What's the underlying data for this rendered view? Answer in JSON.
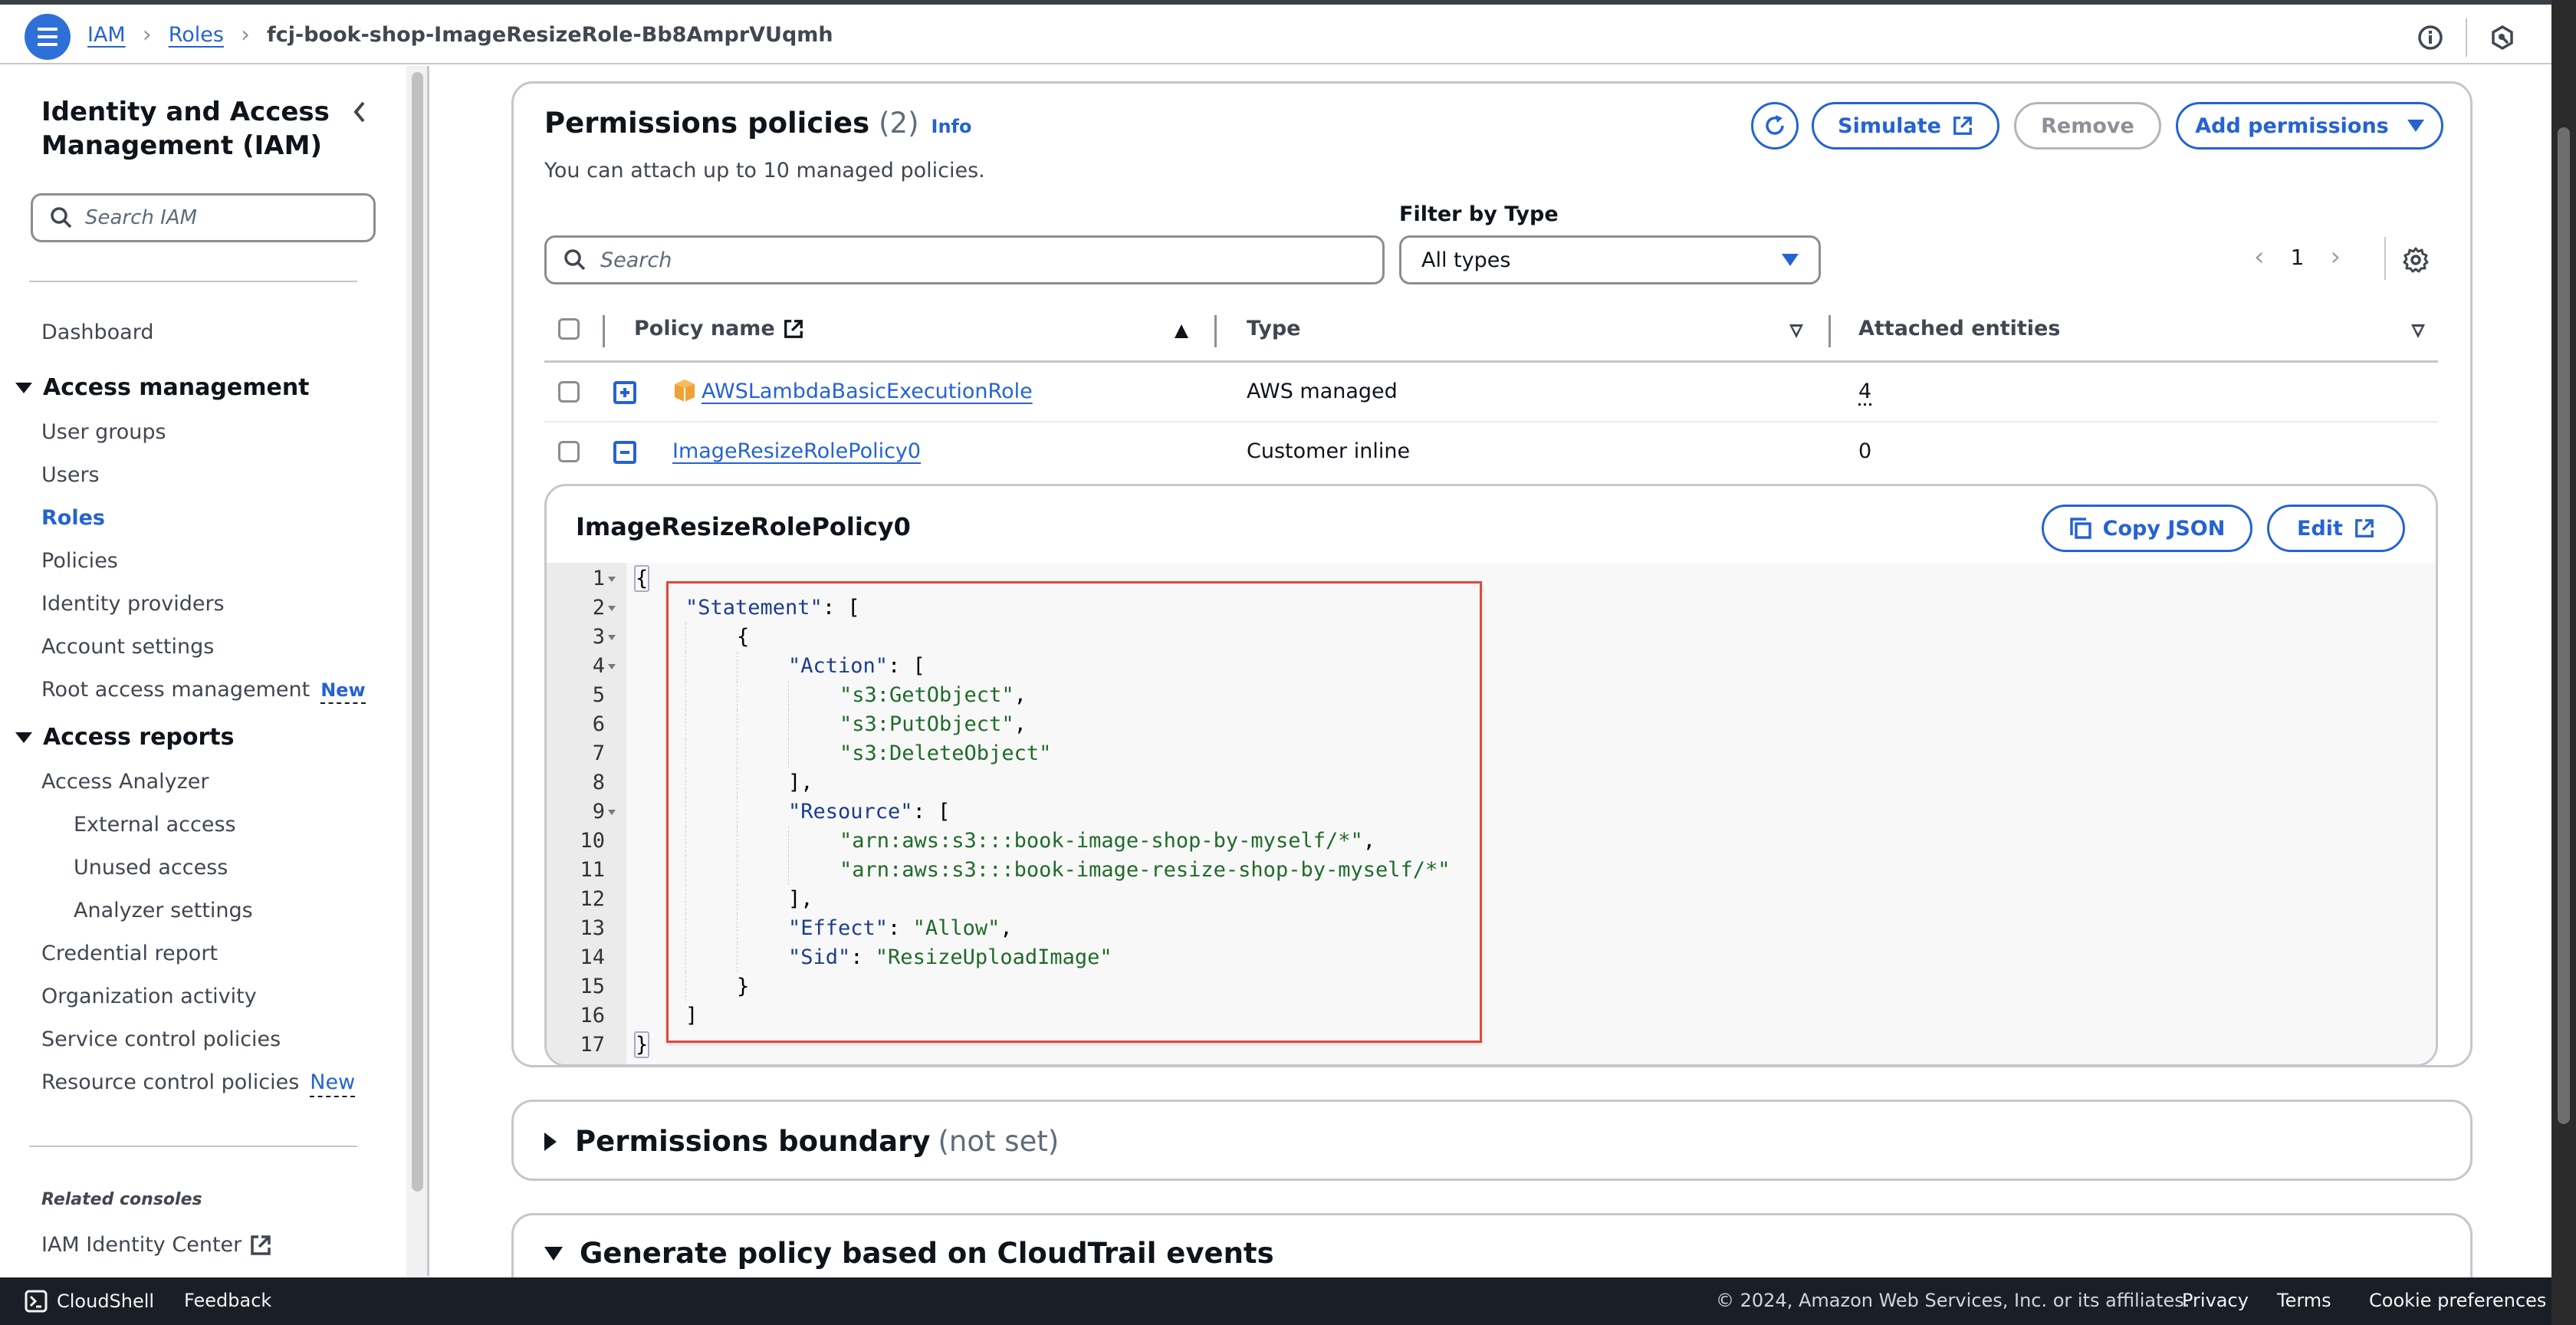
{
  "topbar": {
    "breadcrumbs": [
      {
        "label": "IAM",
        "link": true
      },
      {
        "label": "Roles",
        "link": true
      },
      {
        "label": "fcj-book-shop-ImageResizeRole-Bb8AmprVUqmh",
        "link": false
      }
    ],
    "icons": [
      "info-icon",
      "settings-hexagon-icon"
    ]
  },
  "sidebar": {
    "title": "Identity and Access Management (IAM)",
    "search_placeholder": "Search IAM",
    "dashboard": "Dashboard",
    "sections": [
      {
        "label": "Access management",
        "items": [
          {
            "label": "User groups"
          },
          {
            "label": "Users"
          },
          {
            "label": "Roles",
            "active": true
          },
          {
            "label": "Policies"
          },
          {
            "label": "Identity providers"
          },
          {
            "label": "Account settings"
          },
          {
            "label": "Root access management",
            "badge": "New"
          }
        ]
      },
      {
        "label": "Access reports",
        "items": [
          {
            "label": "Access Analyzer"
          },
          {
            "label": "External access",
            "indent": true
          },
          {
            "label": "Unused access",
            "indent": true
          },
          {
            "label": "Analyzer settings",
            "indent": true
          },
          {
            "label": "Credential report"
          },
          {
            "label": "Organization activity"
          },
          {
            "label": "Service control policies"
          },
          {
            "label": "Resource control policies",
            "badge": "New"
          }
        ]
      }
    ],
    "related_title": "Related consoles",
    "related_items": [
      {
        "label": "IAM Identity Center",
        "external": true
      }
    ]
  },
  "permissions": {
    "title": "Permissions policies",
    "count": "(2)",
    "info": "Info",
    "description": "You can attach up to 10 managed policies.",
    "buttons": {
      "refresh": "refresh",
      "simulate": "Simulate",
      "remove": "Remove",
      "add": "Add permissions"
    },
    "search_placeholder": "Search",
    "filter_label": "Filter by Type",
    "filter_value": "All types",
    "page": "1",
    "columns": {
      "policy_name": "Policy name",
      "type": "Type",
      "attached": "Attached entities"
    },
    "rows": [
      {
        "name": "AWSLambdaBasicExecutionRole",
        "type": "AWS managed",
        "attached": "4",
        "expanded": false,
        "aws_icon": true
      },
      {
        "name": "ImageResizeRolePolicy0",
        "type": "Customer inline",
        "attached": "0",
        "expanded": true,
        "aws_icon": false
      }
    ],
    "inline_policy": {
      "title": "ImageResizeRolePolicy0",
      "copy_json": "Copy JSON",
      "edit": "Edit",
      "code_lines": [
        {
          "n": "1",
          "fold": true,
          "indent": 0,
          "tokens": [
            [
              "punc",
              "{"
            ]
          ]
        },
        {
          "n": "2",
          "fold": true,
          "indent": 1,
          "tokens": [
            [
              "key",
              "\"Statement\""
            ],
            [
              "punc",
              ": ["
            ]
          ]
        },
        {
          "n": "3",
          "fold": true,
          "indent": 2,
          "tokens": [
            [
              "punc",
              "{"
            ]
          ]
        },
        {
          "n": "4",
          "fold": true,
          "indent": 3,
          "tokens": [
            [
              "key",
              "\"Action\""
            ],
            [
              "punc",
              ": ["
            ]
          ]
        },
        {
          "n": "5",
          "fold": false,
          "indent": 4,
          "tokens": [
            [
              "str",
              "\"s3:GetObject\""
            ],
            [
              "punc",
              ","
            ]
          ]
        },
        {
          "n": "6",
          "fold": false,
          "indent": 4,
          "tokens": [
            [
              "str",
              "\"s3:PutObject\""
            ],
            [
              "punc",
              ","
            ]
          ]
        },
        {
          "n": "7",
          "fold": false,
          "indent": 4,
          "tokens": [
            [
              "str",
              "\"s3:DeleteObject\""
            ]
          ]
        },
        {
          "n": "8",
          "fold": false,
          "indent": 3,
          "tokens": [
            [
              "punc",
              "],"
            ]
          ]
        },
        {
          "n": "9",
          "fold": true,
          "indent": 3,
          "tokens": [
            [
              "key",
              "\"Resource\""
            ],
            [
              "punc",
              ": ["
            ]
          ]
        },
        {
          "n": "10",
          "fold": false,
          "indent": 4,
          "tokens": [
            [
              "str",
              "\"arn:aws:s3:::book-image-shop-by-myself/*\""
            ],
            [
              "punc",
              ","
            ]
          ]
        },
        {
          "n": "11",
          "fold": false,
          "indent": 4,
          "tokens": [
            [
              "str",
              "\"arn:aws:s3:::book-image-resize-shop-by-myself/*\""
            ]
          ]
        },
        {
          "n": "12",
          "fold": false,
          "indent": 3,
          "tokens": [
            [
              "punc",
              "],"
            ]
          ]
        },
        {
          "n": "13",
          "fold": false,
          "indent": 3,
          "tokens": [
            [
              "key",
              "\"Effect\""
            ],
            [
              "punc",
              ": "
            ],
            [
              "str",
              "\"Allow\""
            ],
            [
              "punc",
              ","
            ]
          ]
        },
        {
          "n": "14",
          "fold": false,
          "indent": 3,
          "tokens": [
            [
              "key",
              "\"Sid\""
            ],
            [
              "punc",
              ": "
            ],
            [
              "str",
              "\"ResizeUploadImage\""
            ]
          ]
        },
        {
          "n": "15",
          "fold": false,
          "indent": 2,
          "tokens": [
            [
              "punc",
              "}"
            ]
          ]
        },
        {
          "n": "16",
          "fold": false,
          "indent": 1,
          "tokens": [
            [
              "punc",
              "]"
            ]
          ]
        },
        {
          "n": "17",
          "fold": false,
          "indent": 0,
          "tokens": [
            [
              "punc",
              "}"
            ]
          ]
        }
      ]
    }
  },
  "boundary": {
    "title": "Permissions boundary",
    "status": "(not set)"
  },
  "cloudtrail": {
    "title": "Generate policy based on CloudTrail events"
  },
  "footer": {
    "cloudshell": "CloudShell",
    "feedback": "Feedback",
    "copyright": "© 2024, Amazon Web Services, Inc. or its affiliates.",
    "privacy": "Privacy",
    "terms": "Terms",
    "cookies": "Cookie preferences"
  },
  "colors": {
    "accent": "#2563d3",
    "highlight_border": "#e0483a",
    "footer_bg": "#1a1f27",
    "aws_icon": "#f0a134"
  }
}
